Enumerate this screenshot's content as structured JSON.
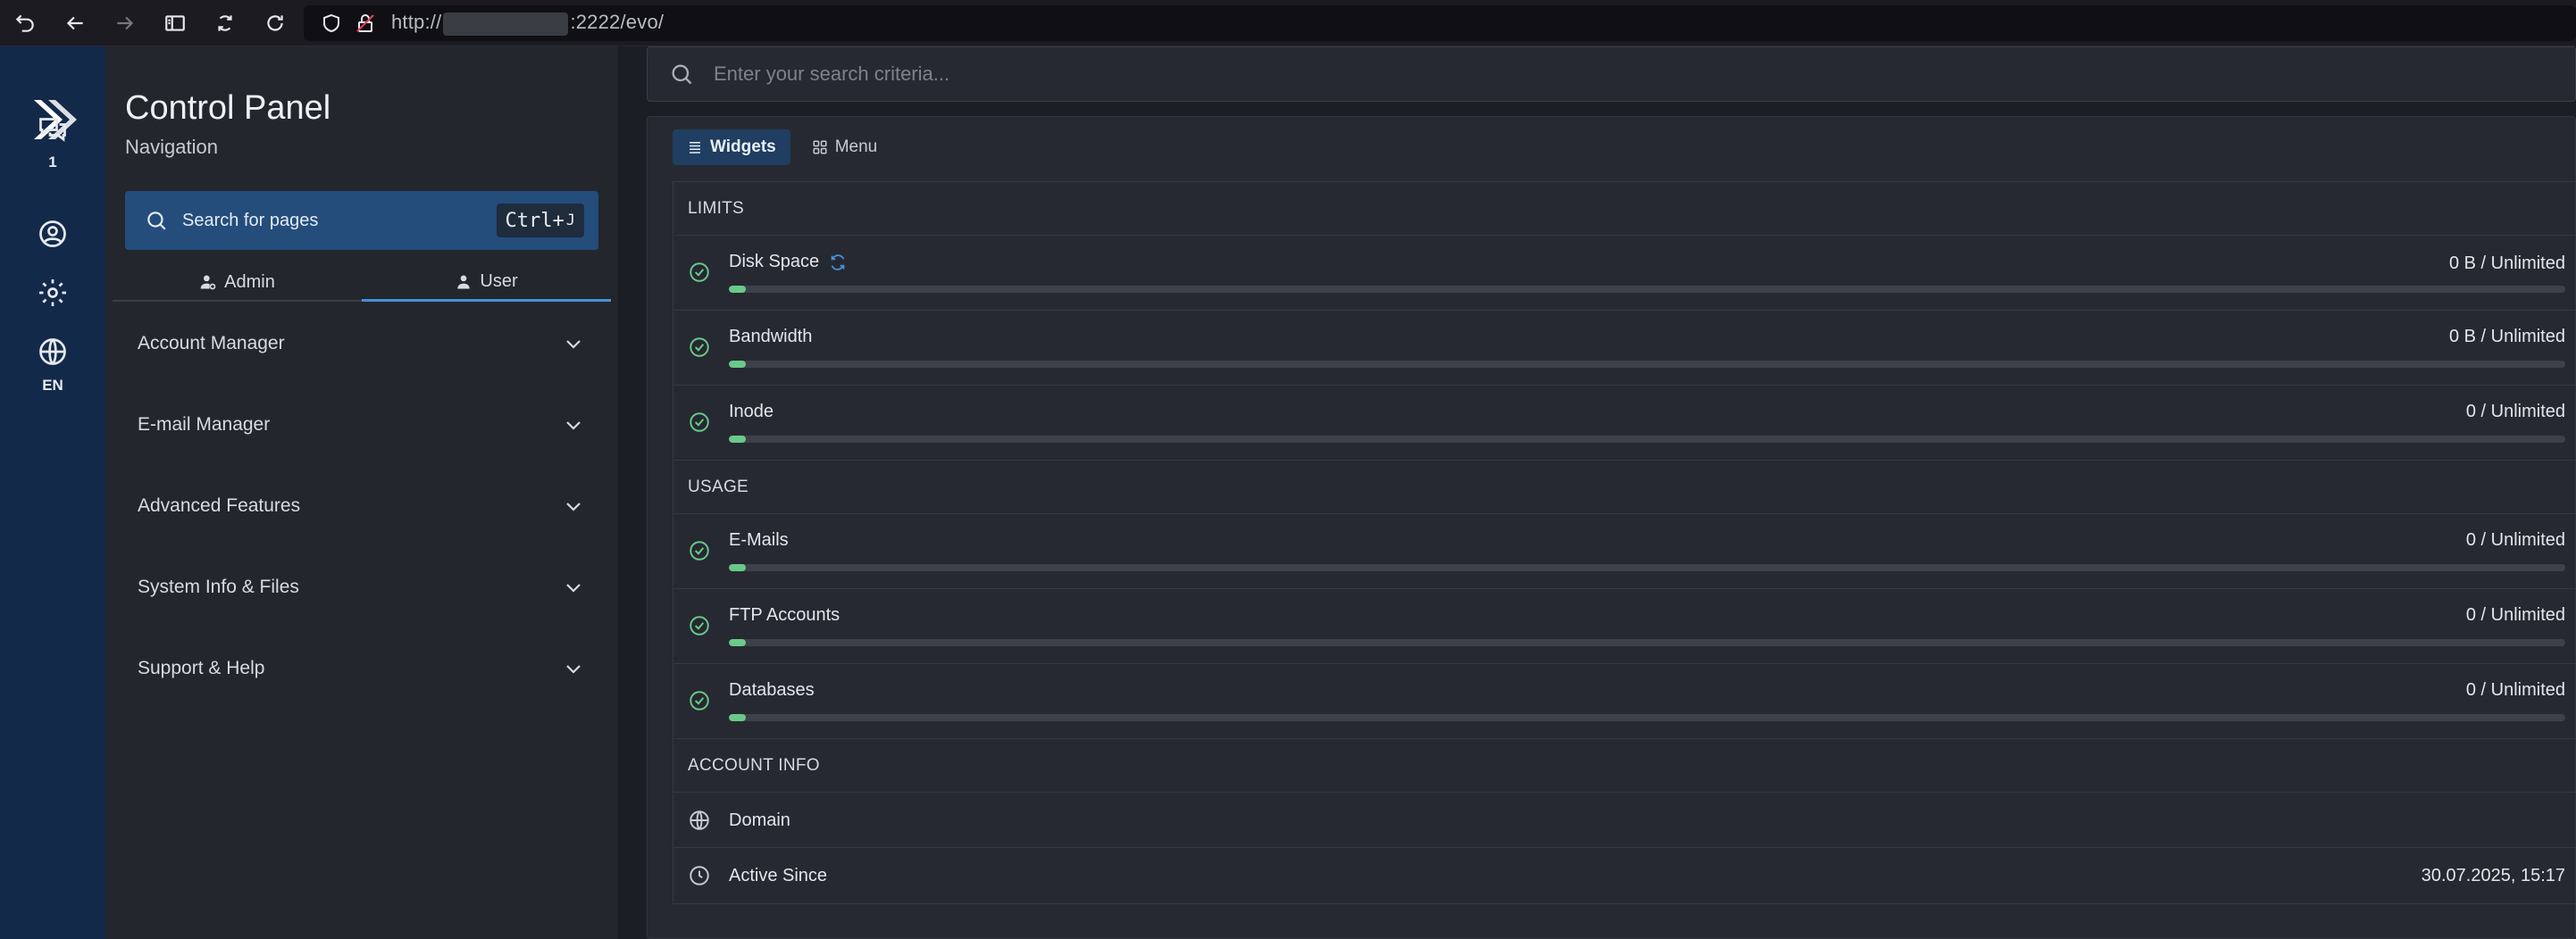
{
  "browser": {
    "url_prefix": "http://",
    "url_suffix": ":2222/evo/"
  },
  "rail": {
    "messages_count": "1",
    "language": "EN"
  },
  "nav": {
    "title": "Control Panel",
    "subtitle": "Navigation",
    "search_label": "Search for pages",
    "shortcut_main": "Ctrl+",
    "shortcut_key": "J",
    "role_tabs": [
      {
        "label": "Admin",
        "active": false
      },
      {
        "label": "User",
        "active": true
      }
    ],
    "sections": [
      {
        "label": "Account Manager"
      },
      {
        "label": "E-mail Manager"
      },
      {
        "label": "Advanced Features"
      },
      {
        "label": "System Info & Files"
      },
      {
        "label": "Support & Help"
      }
    ]
  },
  "main": {
    "search_placeholder": "Enter your search criteria...",
    "view_tabs": [
      {
        "label": "Widgets",
        "active": true
      },
      {
        "label": "Menu",
        "active": false
      }
    ],
    "limits": {
      "heading": "LIMITS",
      "items": [
        {
          "name": "Disk Space",
          "value": "0 B / Unlimited",
          "fraction": 0.005
        },
        {
          "name": "Bandwidth",
          "value": "0 B / Unlimited",
          "fraction": 0.005
        },
        {
          "name": "Inode",
          "value": "0 / Unlimited",
          "fraction": 0.005
        }
      ]
    },
    "usage": {
      "heading": "USAGE",
      "items": [
        {
          "name": "E-Mails",
          "value": "0 / Unlimited",
          "fraction": 0.005
        },
        {
          "name": "FTP Accounts",
          "value": "0 / Unlimited",
          "fraction": 0.005
        },
        {
          "name": "Databases",
          "value": "0 / Unlimited",
          "fraction": 0.005
        }
      ]
    },
    "account_info": {
      "heading": "ACCOUNT INFO",
      "domain_label": "Domain",
      "domain_value": "",
      "active_since_label": "Active Since",
      "active_since_value": "30.07.2025, 15:17"
    }
  },
  "colors": {
    "rail": "#13294a",
    "accent": "#4a8fd8",
    "success": "#6ac98a"
  }
}
